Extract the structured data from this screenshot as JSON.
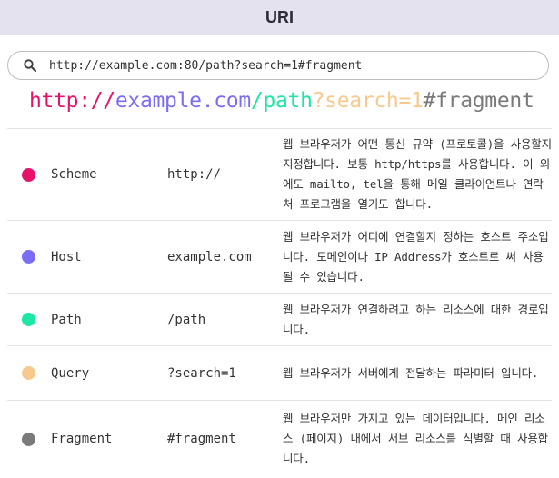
{
  "title": "URI",
  "search": {
    "value": "http://example.com:80/path?search=1#fragment",
    "icon": "search-icon"
  },
  "uri_parts": [
    {
      "text": "http://",
      "color": "#e8116a"
    },
    {
      "text": "example.com",
      "color": "#7b6cf6"
    },
    {
      "text": "/path",
      "color": "#1ee6a3"
    },
    {
      "text": "?search=1",
      "color": "#f8c98d"
    },
    {
      "text": "#fragment",
      "color": "#7a7a7a"
    }
  ],
  "rows": [
    {
      "name": "Scheme",
      "value": "http://",
      "color": "#e8116a",
      "desc": "웹 브라우저가 어떤 통신 규약 (프로토콜)을 사용할지 지정합니다. 보통 http/https를 사용합니다. 이 외에도 mailto, tel을 통해 메일 클라이언트나 연락처 프로그램을 열기도 합니다."
    },
    {
      "name": "Host",
      "value": "example.com",
      "color": "#7b6cf6",
      "desc": "웹 브라우저가 어디에 연결할지 정하는 호스트 주소입니다. 도메인이나 IP Address가 호스트로 써 사용될 수 있습니다."
    },
    {
      "name": "Path",
      "value": "/path",
      "color": "#1ee6a3",
      "desc": "웹 브라우저가 연결하려고 하는 리소스에 대한 경로입니다."
    },
    {
      "name": "Query",
      "value": "?search=1",
      "color": "#f8c98d",
      "desc": "웹 브라우저가 서버에게 전달하는 파라미터 입니다."
    },
    {
      "name": "Fragment",
      "value": "#fragment",
      "color": "#7a7a7a",
      "desc": "웹 브라우저만 가지고 있는 데이터입니다. 메인 리소스 (페이지) 내에서 서브 리소스를 식별할 때 사용합니다."
    }
  ]
}
